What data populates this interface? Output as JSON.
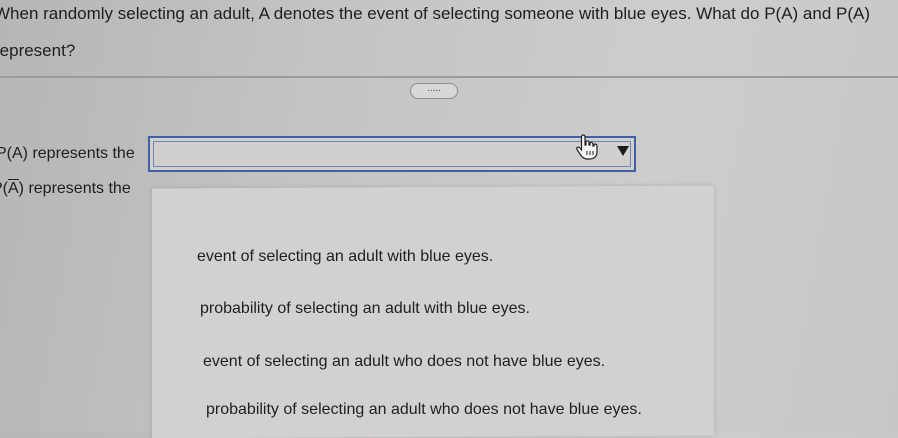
{
  "question": {
    "line1": "When randomly selecting an adult, A denotes the event of selecting someone with blue eyes. What do P(A) and P(A)",
    "line2": "represent?"
  },
  "more_button": {
    "label": "....."
  },
  "rows": [
    {
      "label": "P(A) represents the"
    },
    {
      "prefix": "P(",
      "letter": "A",
      "suffix": ") represents the"
    }
  ],
  "select": {
    "value": ""
  },
  "icons": {
    "cursor": "hand-pointer-icon",
    "dropdown": "triangle-down-icon"
  },
  "options": [
    "event of selecting an adult with blue eyes.",
    "probability of selecting an adult with blue eyes.",
    "event of selecting an adult who does not have blue eyes.",
    "probability of selecting an adult who does not have blue eyes."
  ],
  "colors": {
    "select_border": "#3d62a8"
  }
}
